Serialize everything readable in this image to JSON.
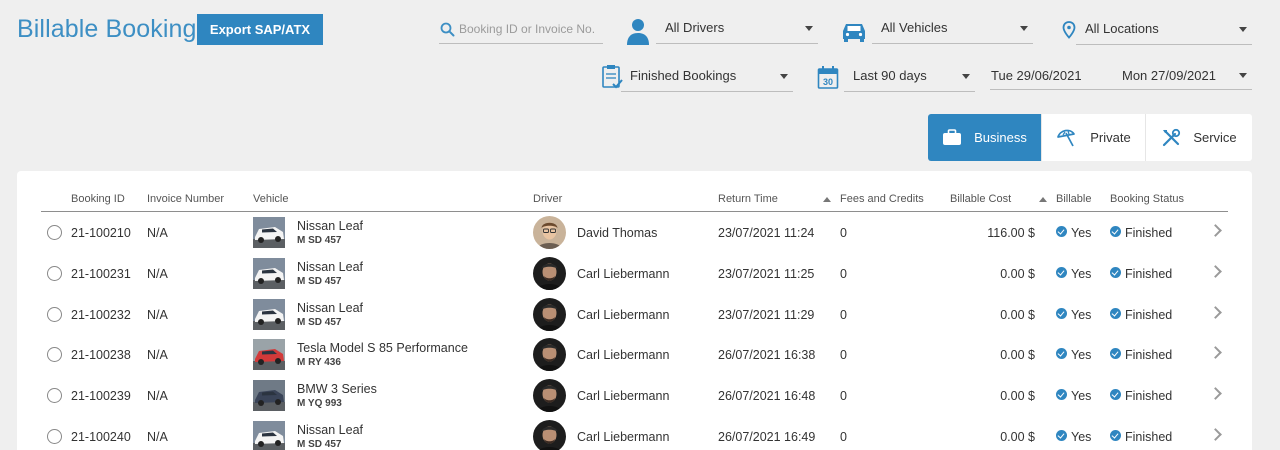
{
  "header": {
    "title": "Billable Bookings",
    "export_label": "Export SAP/ATX"
  },
  "search": {
    "placeholder": "Booking ID or Invoice No."
  },
  "filters": {
    "drivers": "All Drivers",
    "vehicles": "All Vehicles",
    "locations": "All Locations",
    "status": "Finished Bookings",
    "period": "Last 90 days",
    "calendar_day": "30",
    "date_from": "Tue 29/06/2021",
    "date_to": "Mon 27/09/2021"
  },
  "segments": {
    "business": "Business",
    "private": "Private",
    "service": "Service"
  },
  "table": {
    "columns": {
      "booking_id": "Booking ID",
      "invoice": "Invoice Number",
      "vehicle": "Vehicle",
      "driver": "Driver",
      "return_time": "Return Time",
      "fees": "Fees and Credits",
      "cost": "Billable Cost",
      "billable": "Billable",
      "status": "Booking Status"
    },
    "rows": [
      {
        "id": "21-100210",
        "invoice": "N/A",
        "vehicle": "Nissan Leaf",
        "plate": "M SD 457",
        "driver": "David Thomas",
        "return_time": "23/07/2021 11:24",
        "fees": "0",
        "cost": "116.00 $",
        "billable": "Yes",
        "status": "Finished"
      },
      {
        "id": "21-100231",
        "invoice": "N/A",
        "vehicle": "Nissan Leaf",
        "plate": "M SD 457",
        "driver": "Carl Liebermann",
        "return_time": "23/07/2021 11:25",
        "fees": "0",
        "cost": "0.00 $",
        "billable": "Yes",
        "status": "Finished"
      },
      {
        "id": "21-100232",
        "invoice": "N/A",
        "vehicle": "Nissan Leaf",
        "plate": "M SD 457",
        "driver": "Carl Liebermann",
        "return_time": "23/07/2021 11:29",
        "fees": "0",
        "cost": "0.00 $",
        "billable": "Yes",
        "status": "Finished"
      },
      {
        "id": "21-100238",
        "invoice": "N/A",
        "vehicle": "Tesla Model S 85 Performance",
        "plate": "M RY 436",
        "driver": "Carl Liebermann",
        "return_time": "26/07/2021 16:38",
        "fees": "0",
        "cost": "0.00 $",
        "billable": "Yes",
        "status": "Finished"
      },
      {
        "id": "21-100239",
        "invoice": "N/A",
        "vehicle": "BMW 3 Series",
        "plate": "M YQ 993",
        "driver": "Carl Liebermann",
        "return_time": "26/07/2021 16:48",
        "fees": "0",
        "cost": "0.00 $",
        "billable": "Yes",
        "status": "Finished"
      },
      {
        "id": "21-100240",
        "invoice": "N/A",
        "vehicle": "Nissan Leaf",
        "plate": "M SD 457",
        "driver": "Carl Liebermann",
        "return_time": "26/07/2021 16:49",
        "fees": "0",
        "cost": "0.00 $",
        "billable": "Yes",
        "status": "Finished"
      }
    ]
  },
  "colors": {
    "accent": "#2f86c0",
    "title": "#3d8fc4",
    "background": "#efefef"
  }
}
